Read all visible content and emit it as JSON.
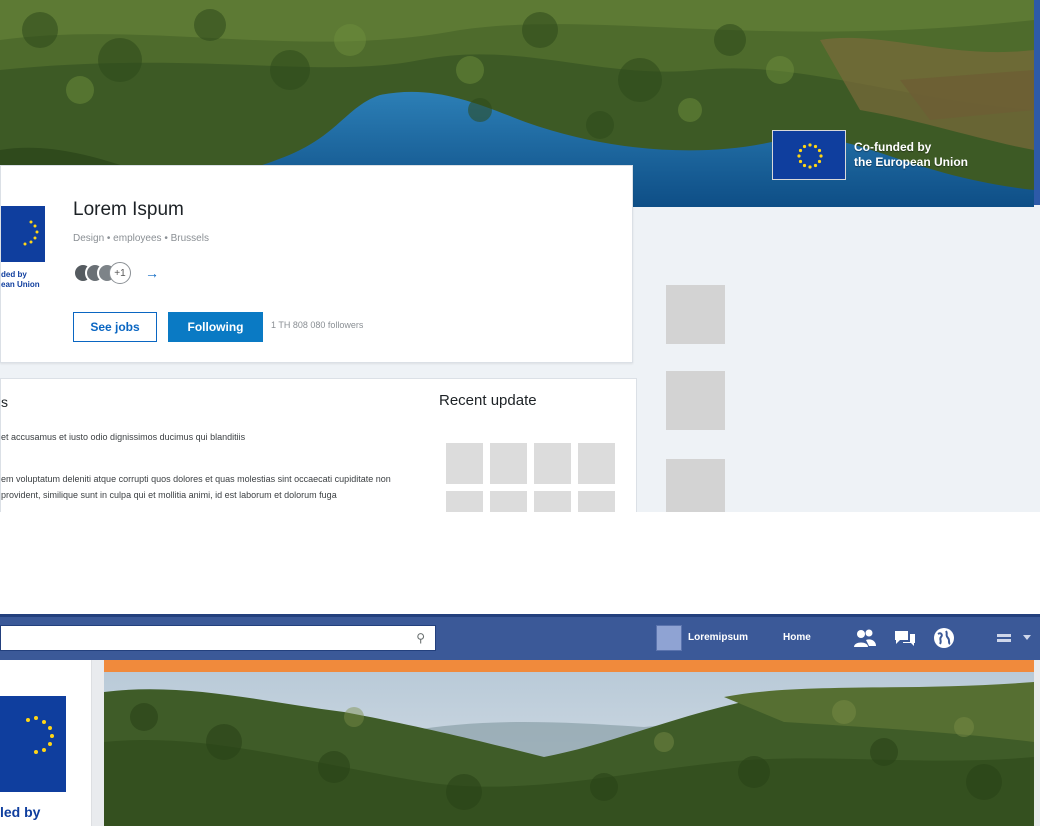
{
  "top": {
    "banner_eu": {
      "line1": "Co-funded by",
      "line2": "the European Union"
    },
    "profile": {
      "logo_caption_line1": "ded by",
      "logo_caption_line2": "ean Union",
      "name": "Lorem Ispum",
      "meta": "Design • employees • Brussels",
      "connections_more": "+1",
      "connections_arrow": "→",
      "see_jobs_label": "See jobs",
      "following_label": "Following",
      "followers": "1 TH 808 080 followers"
    },
    "about": {
      "title_fragment": "s",
      "p1": "et accusamus et iusto odio dignissimos ducimus qui blanditiis",
      "p2": "em voluptatum deleniti atque corrupti quos dolores et quas molestias sint occaecati cupiditate non provident, similique sunt in culpa qui",
      "p3": "et mollitia animi, id est laborum et dolorum fuga"
    },
    "recent_update_title": "Recent update"
  },
  "bottom": {
    "search": {
      "placeholder": "",
      "icon": "search-icon"
    },
    "user_name": "Loremipsum",
    "home_label": "Home",
    "icons": [
      "friends-icon",
      "messages-icon",
      "globe-icon",
      "menu-icon"
    ],
    "logo_caption": "led by"
  },
  "colors": {
    "eu_blue": "#0f3e9e",
    "eu_star": "#ffd617",
    "linkedin_blue": "#0a7ac4",
    "facebook_blue": "#3b5998",
    "orange_bar": "#f08a3c"
  }
}
